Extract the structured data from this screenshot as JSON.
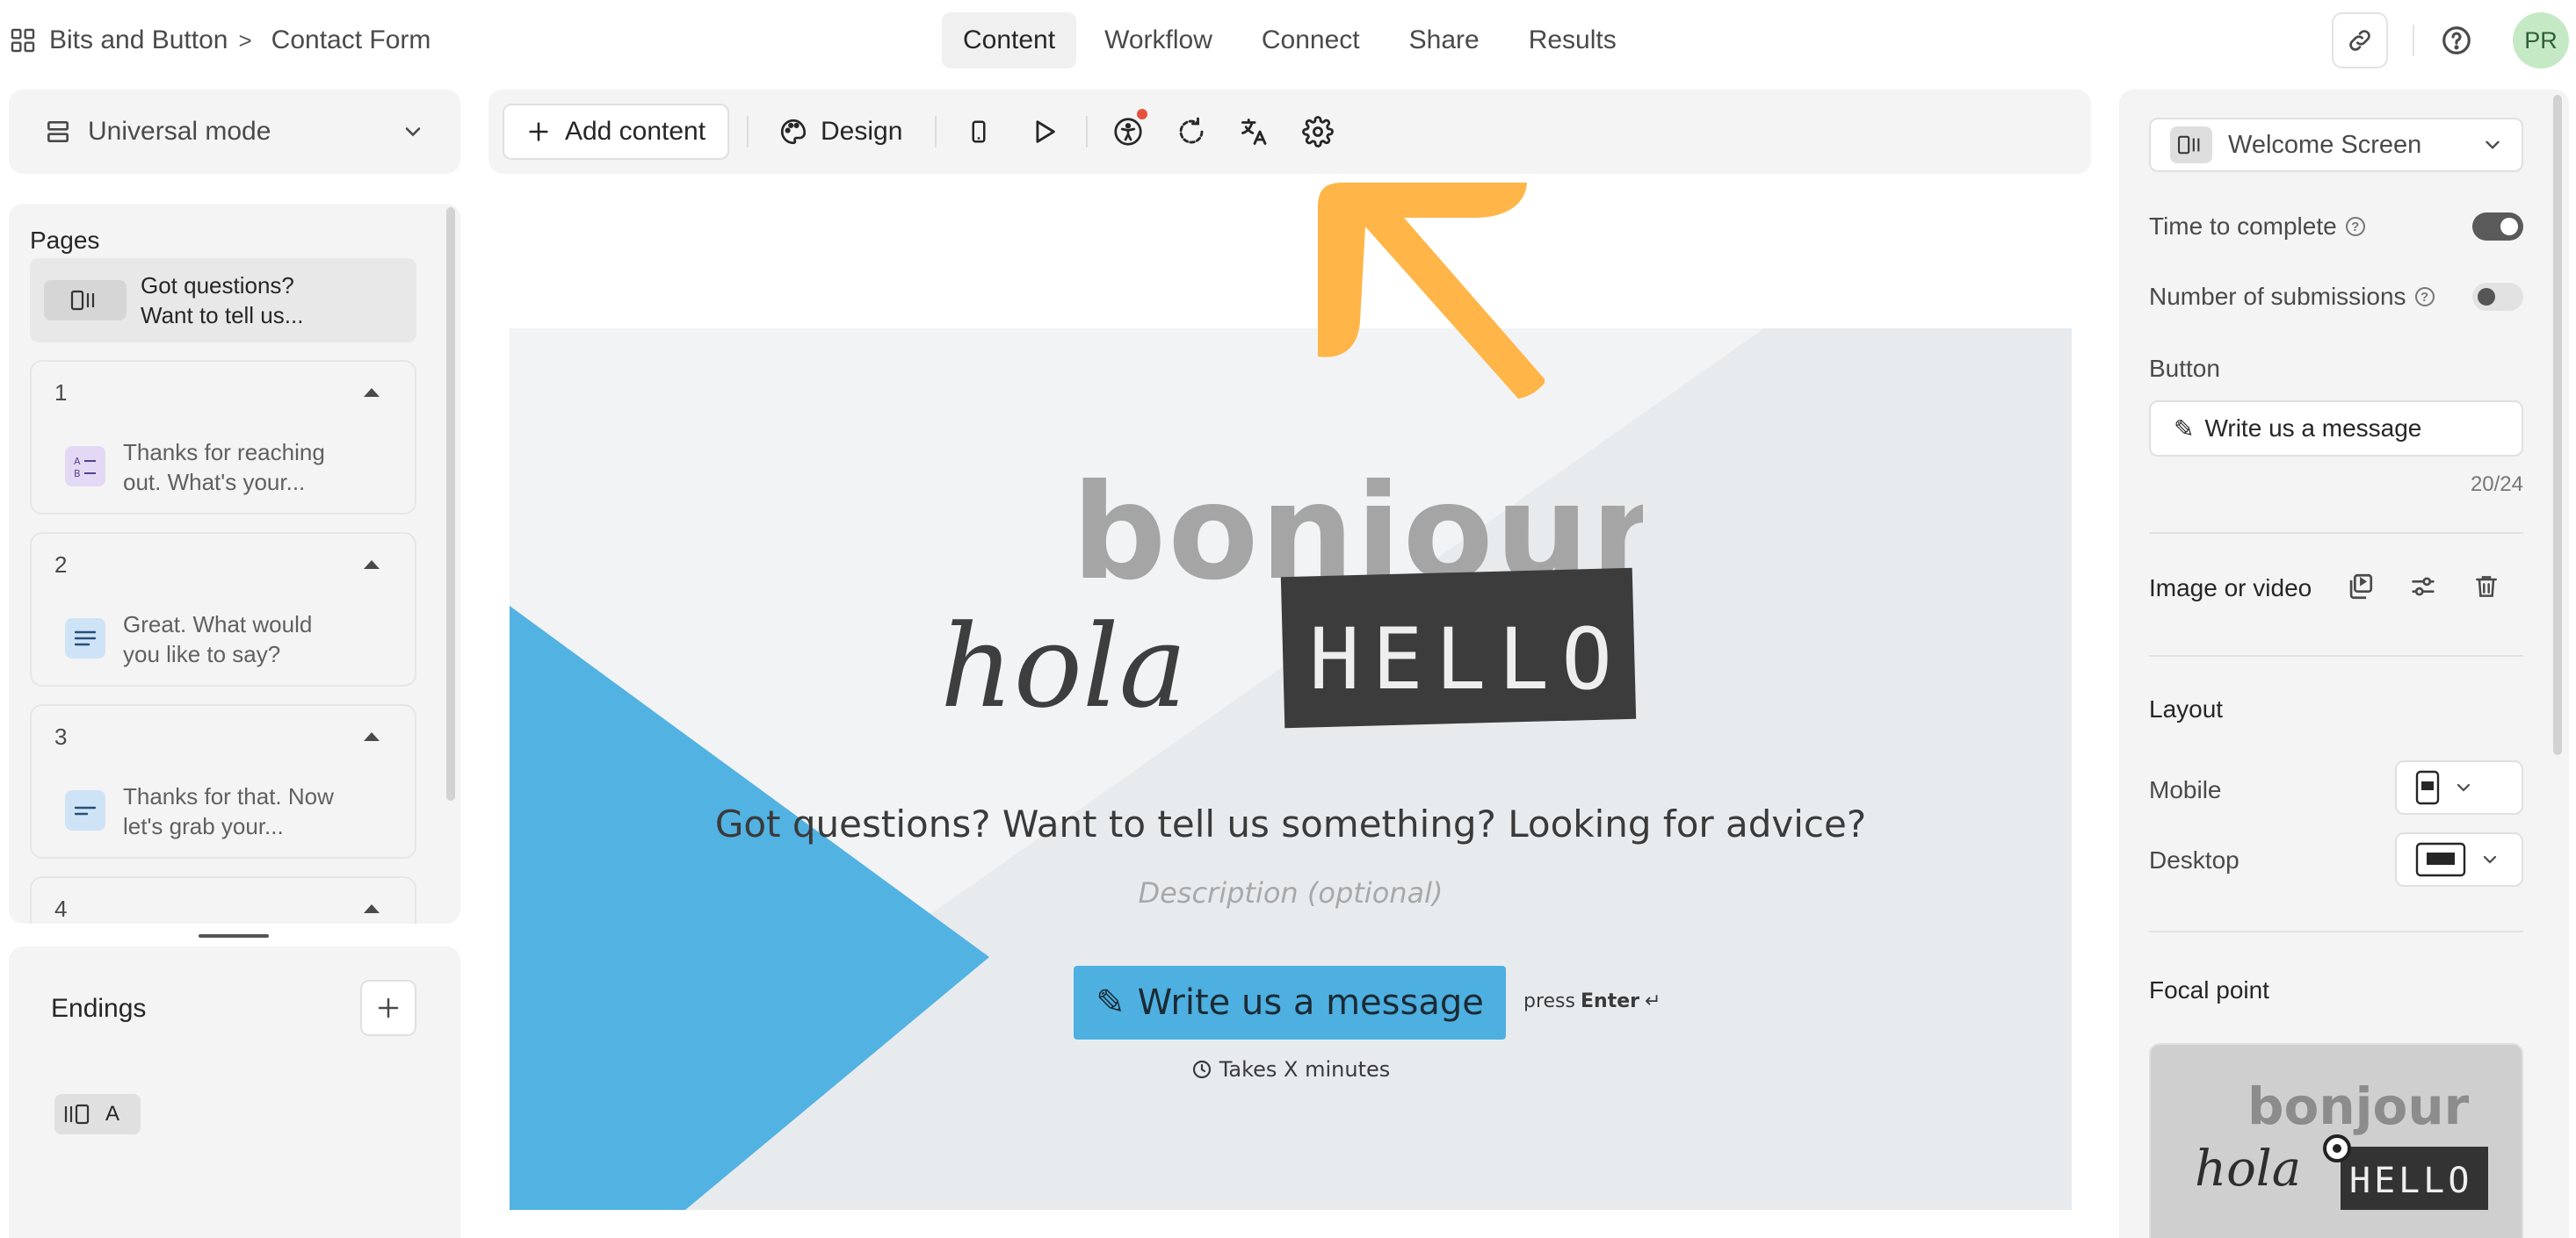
{
  "breadcrumb": {
    "workspace": "Bits and Button",
    "separator": ">",
    "form": "Contact Form"
  },
  "nav_tabs": [
    "Content",
    "Workflow",
    "Connect",
    "Share",
    "Results"
  ],
  "active_tab": "Content",
  "avatar_initials": "PR",
  "mode": {
    "label": "Universal mode"
  },
  "pages": {
    "title": "Pages",
    "welcome": {
      "line1": "Got questions?",
      "line2": "Want to tell us..."
    },
    "items": [
      {
        "number": "1",
        "line1": "Thanks for reaching",
        "line2": "out. What's your...",
        "icon": "multiple-choice-icon",
        "icon_color": "#e3d9f5"
      },
      {
        "number": "2",
        "line1": "Great. What would",
        "line2": "you like to say?",
        "icon": "long-text-icon",
        "icon_color": "#cfe3f7"
      },
      {
        "number": "3",
        "line1": "Thanks for that. Now",
        "line2": "let's grab your...",
        "icon": "short-text-icon",
        "icon_color": "#cfe3f7"
      },
      {
        "number": "4",
        "line1": "",
        "line2": ""
      }
    ]
  },
  "endings": {
    "title": "Endings",
    "chip_label": "A"
  },
  "toolbar": {
    "add_content": "Add content",
    "design": "Design"
  },
  "canvas": {
    "hero_words": {
      "bonjour": "bonjour",
      "hola": "hola",
      "hello": "HELLO"
    },
    "headline": "Got questions? Want to tell us something? Looking for advice?",
    "description_placeholder": "Description (optional)",
    "button_label": "Write us a message",
    "button_emoji": "✎",
    "press_text": "press",
    "press_key": "Enter",
    "press_symbol": "↵",
    "time_text": "Takes X minutes",
    "accent_color": "#4db0e0"
  },
  "annotation": {
    "arrow_color": "#ffb547"
  },
  "right_panel": {
    "screen_select": "Welcome Screen",
    "time_to_complete": {
      "label": "Time to complete",
      "on": true
    },
    "submissions": {
      "label": "Number of submissions",
      "on": false
    },
    "button_section": "Button",
    "button_value": "Write us a message",
    "button_prefix": "✎",
    "counter": "20/24",
    "image_video": "Image or video",
    "layout_title": "Layout",
    "mobile_label": "Mobile",
    "desktop_label": "Desktop",
    "focal_title": "Focal point"
  }
}
